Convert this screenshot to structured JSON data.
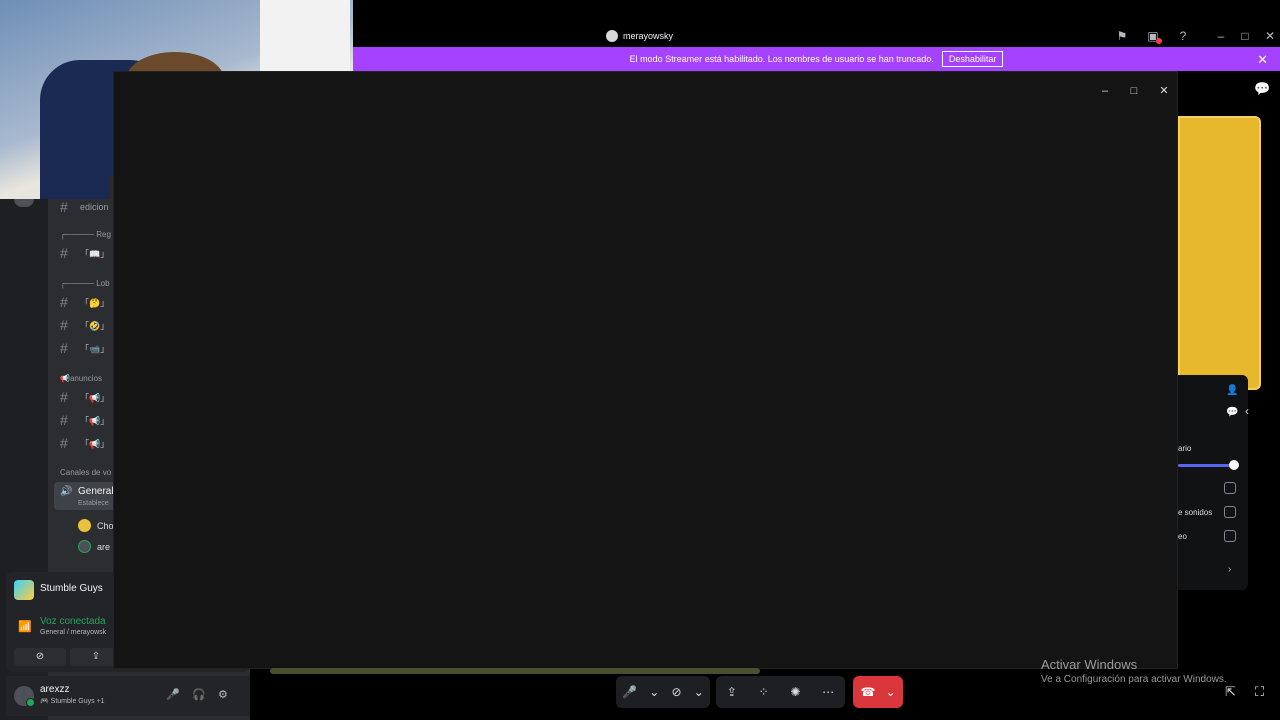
{
  "titlebar": {
    "title": "merayowsky",
    "icons": [
      "inbox-flag-icon",
      "screen-share-alert-icon",
      "help-icon"
    ],
    "window_controls": [
      "minimize-icon",
      "maximize-icon",
      "close-icon"
    ]
  },
  "banner": {
    "text": "El modo Streamer está habilitado. Los nombres de usuario se han truncado.",
    "button": "Deshabilitar"
  },
  "sidebar": {
    "channels": [
      {
        "name": "edicion",
        "type": "text"
      },
      {
        "name": "Reg",
        "type": "category"
      },
      {
        "name": "「📖」",
        "type": "text"
      },
      {
        "name": "Lob",
        "type": "category"
      },
      {
        "name": "「🤔」",
        "type": "text"
      },
      {
        "name": "「🤣」",
        "type": "text"
      },
      {
        "name": "「📹」",
        "type": "text"
      },
      {
        "name": "📢anuncios",
        "type": "category"
      },
      {
        "name": "「📢」",
        "type": "text"
      },
      {
        "name": "「📢」",
        "type": "text"
      },
      {
        "name": "「📢」",
        "type": "text"
      }
    ],
    "voice_category": "Canales de vo",
    "voice_channel": {
      "name": "General",
      "sub": "Establece"
    },
    "voice_users": [
      "Cho",
      "are"
    ]
  },
  "activity": {
    "game": "Stumble Guys",
    "voice_status": "Voz conectada",
    "voice_sub": "General / merayowsk"
  },
  "user": {
    "name": "arexzz",
    "status": "🎮 Stumble Guys +1"
  },
  "popup": {
    "label_volume": "ario",
    "label_sounds": "e sonidos",
    "label_video": "eo"
  },
  "windows_activation": {
    "title": "Activar Windows",
    "sub": "Ve a Configuración para activar Windows."
  },
  "colors": {
    "banner": "#a442ff",
    "leave": "#da373c",
    "connected": "#23a55a",
    "tile": "#e7b82c"
  }
}
